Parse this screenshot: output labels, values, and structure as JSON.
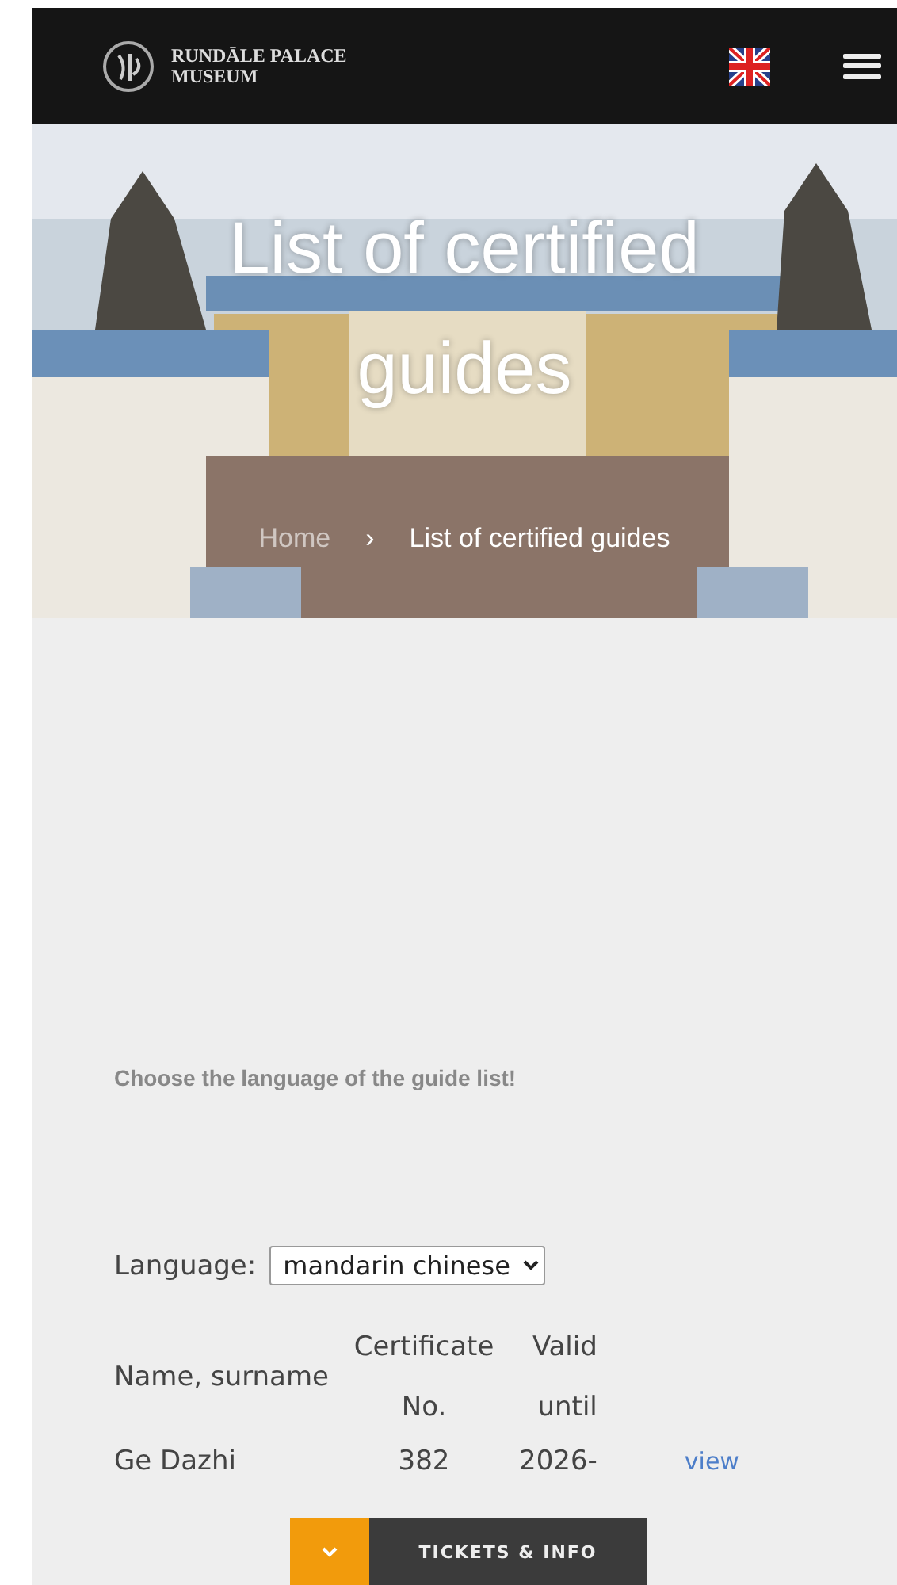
{
  "header": {
    "logo_text": [
      "RUNDĀLE PALACE",
      "MUSEUM"
    ]
  },
  "hero": {
    "kind": "picture",
    "title": "List of certified guides",
    "breadcrumb": [
      "Home",
      "›",
      "List of certified guides"
    ]
  },
  "intro": "Choose the language of the guide list!",
  "language_filter": {
    "label": "Language:",
    "value": "mandarin chinese"
  },
  "table": {
    "columns": [
      {
        "lines": [
          "Name, surname"
        ]
      },
      {
        "lines": [
          "Certificate",
          "No."
        ]
      },
      {
        "lines": [
          "Valid",
          "until"
        ]
      }
    ],
    "rows": [
      {
        "name": "Ge Dazhi",
        "certificate": "382",
        "valid": "2026-",
        "link": "view"
      }
    ]
  },
  "bottom_bar": {
    "label": "TICKETS & INFO"
  }
}
